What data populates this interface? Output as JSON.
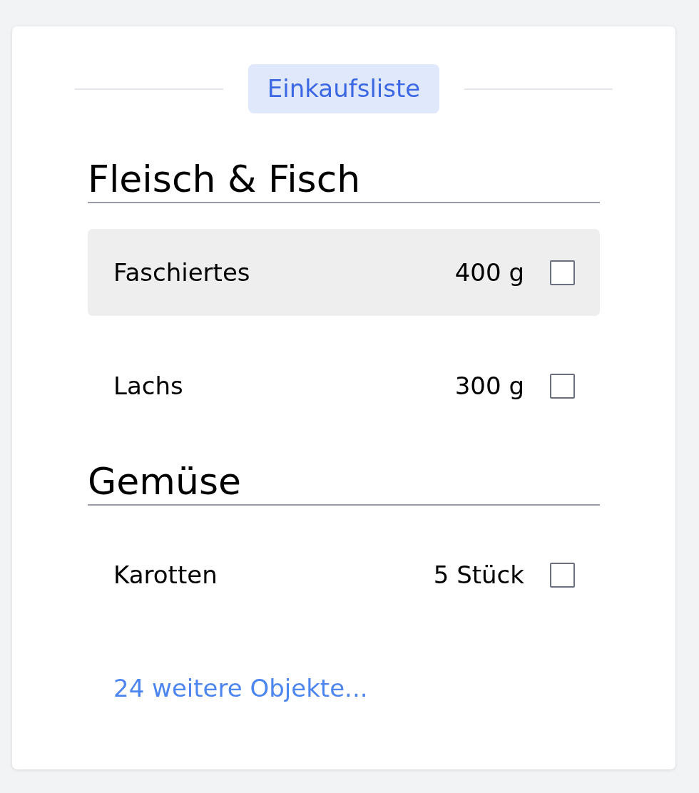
{
  "title": "Einkaufsliste",
  "sections": [
    {
      "heading": "Fleisch & Fisch",
      "items": [
        {
          "name": "Faschiertes",
          "quantity": "400 g",
          "checked": false,
          "selected": true
        },
        {
          "name": "Lachs",
          "quantity": "300 g",
          "checked": false,
          "selected": false
        }
      ]
    },
    {
      "heading": "Gemüse",
      "items": [
        {
          "name": "Karotten",
          "quantity": "5 Stück",
          "checked": false,
          "selected": false
        }
      ]
    }
  ],
  "more_link": "24 weitere Objekte..."
}
